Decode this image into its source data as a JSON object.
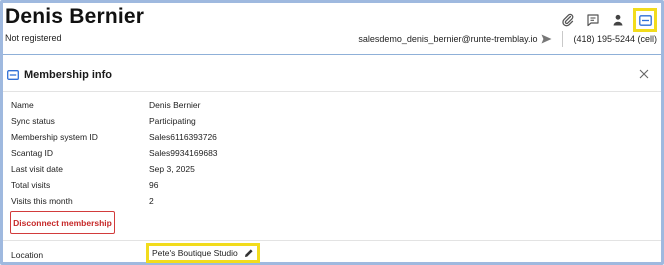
{
  "contact": {
    "name": "Denis Bernier",
    "registration_status": "Not registered",
    "email": "salesdemo_denis_bernier@runte-tremblay.io",
    "phone": "(418) 195-5244 (cell)"
  },
  "header_icons": [
    "paperclip-icon",
    "note-icon",
    "person-icon",
    "membership-card-icon"
  ],
  "panel": {
    "title": "Membership info",
    "fields": [
      {
        "label": "Name",
        "value": "Denis Bernier"
      },
      {
        "label": "Sync status",
        "value": "Participating"
      },
      {
        "label": "Membership system ID",
        "value": "Sales6116393726"
      },
      {
        "label": "Scantag ID",
        "value": "Sales9934169683"
      },
      {
        "label": "Last visit date",
        "value": "Sep 3, 2025"
      },
      {
        "label": "Total visits",
        "value": "96"
      },
      {
        "label": "Visits this month",
        "value": "2"
      }
    ],
    "disconnect_label": "Disconnect membership",
    "location_label": "Location",
    "location_value": "Pete's Boutique Studio"
  },
  "colors": {
    "accent_blue": "#2f6fd6",
    "highlight_yellow": "#f2dc1c",
    "danger_red": "#c62828",
    "frame_border": "#9fb9df"
  }
}
